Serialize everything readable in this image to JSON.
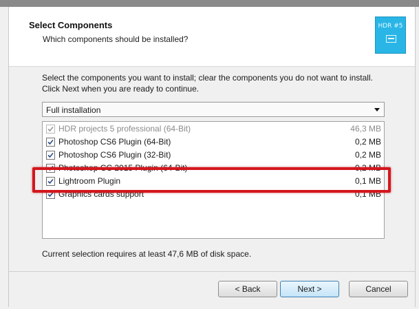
{
  "header": {
    "title": "Select Components",
    "subtitle": "Which components should be installed?",
    "logo_text": "HDR #5"
  },
  "description": "Select the components you want to install; clear the components you do not want to install. Click Next when you are ready to continue.",
  "install_type": {
    "selected": "Full installation"
  },
  "components": [
    {
      "label": "HDR projects 5 professional (64-Bit)",
      "size": "46,3 MB",
      "checked": true,
      "disabled": true
    },
    {
      "label": "Photoshop CS6 Plugin (64-Bit)",
      "size": "0,2 MB",
      "checked": true,
      "disabled": false
    },
    {
      "label": "Photoshop CS6 Plugin (32-Bit)",
      "size": "0,2 MB",
      "checked": true,
      "disabled": false
    },
    {
      "label": "Photoshop CC 2015 Plugin (64-Bit)",
      "size": "0,2 MB",
      "checked": true,
      "disabled": false
    },
    {
      "label": "Lightroom Plugin",
      "size": "0,1 MB",
      "checked": true,
      "disabled": false
    },
    {
      "label": "Graphics cards support",
      "size": "0,1 MB",
      "checked": true,
      "disabled": false
    }
  ],
  "disk_space": "Current selection requires at least 47,6 MB of disk space.",
  "buttons": {
    "back": "< Back",
    "next": "Next >",
    "cancel": "Cancel"
  },
  "colors": {
    "highlight": "#d3171e",
    "logo_bg": "#29b6e6"
  }
}
